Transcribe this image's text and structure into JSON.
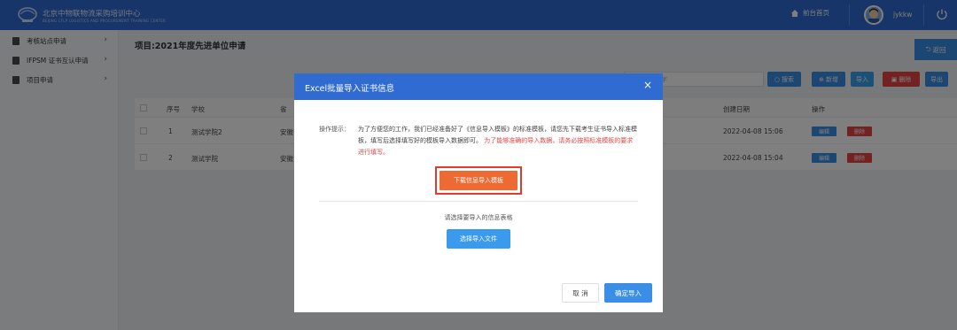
{
  "header": {
    "logo_text": "北京中物联物流采购培训中心",
    "logo_sub": "BEIJING CFLP LOGISTICS AND PROCUREMENT TRAINING CENTER",
    "home_label": "前台首页",
    "username": "jykkw"
  },
  "sidebar": {
    "items": [
      {
        "label": "考核站点申请"
      },
      {
        "label": "IFPSM 证书互认申请"
      },
      {
        "label": "项目申请"
      }
    ]
  },
  "main": {
    "title": "项目:2021年度先进单位申请",
    "back_label": "返回",
    "search_placeholder": "请输入关键字",
    "toolbar": {
      "search": "搜索",
      "add": "新增",
      "import": "导入",
      "delete": "删除",
      "export": "导出"
    },
    "table": {
      "headers": {
        "index": "序号",
        "school": "学校",
        "province": "省",
        "created": "创建日期",
        "actions": "操作"
      },
      "rows": [
        {
          "index": "1",
          "school": "测试学院2",
          "province": "安徽",
          "created": "2022-04-08 15:06"
        },
        {
          "index": "2",
          "school": "测试学院",
          "province": "安徽",
          "created": "2022-04-08 15:04"
        }
      ],
      "edit_label": "编辑",
      "delete_label": "删除"
    }
  },
  "modal": {
    "title": "Excel批量导入证书信息",
    "op_label": "操作提示：",
    "op_text": "为了方便您的工作，我们已经准备好了《信息导入模板》的标准模板，请您先下载考生证书导入标准模板，填写后选择填写好的模板导入数据即可。",
    "op_warning": "为了能够准确的导入数据，请务必按照标准模板的要求进行填写。",
    "download_label": "下载信息导入模板",
    "pick_hint": "请选择要导入的信息表格",
    "pick_label": "选择导入文件",
    "cancel_label": "取 消",
    "ok_label": "确定导入"
  },
  "colors": {
    "primary": "#2f6bd1",
    "accent": "#ee6a33",
    "danger": "#e64545"
  }
}
